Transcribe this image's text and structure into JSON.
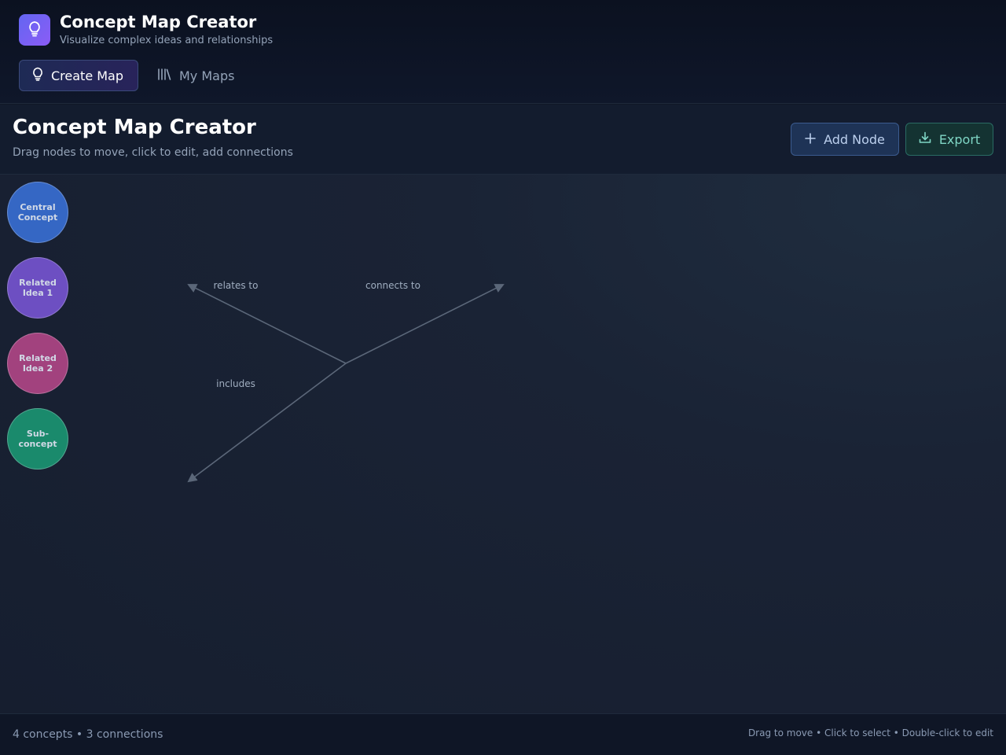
{
  "app": {
    "title": "Concept Map Creator",
    "subtitle": "Visualize complex ideas and relationships",
    "logo_icon": "lightbulb-icon"
  },
  "tabs": [
    {
      "label": "Create Map",
      "icon": "lightbulb-icon",
      "active": true
    },
    {
      "label": "My Maps",
      "icon": "library-icon",
      "active": false
    }
  ],
  "toolbar": {
    "title": "Concept Map Creator",
    "hint": "Drag nodes to move, click to edit, add connections",
    "add_node_label": "Add Node",
    "export_label": "Export"
  },
  "nodes": [
    {
      "line1": "Central",
      "line2": "Concept",
      "color": "#3567c4"
    },
    {
      "line1": "Related",
      "line2": "Idea 1",
      "color": "#6d4fc2"
    },
    {
      "line1": "Related",
      "line2": "Idea 2",
      "color": "#a2427e"
    },
    {
      "line1": "Sub-",
      "line2": "concept",
      "color": "#1a8a6c"
    }
  ],
  "connections": [
    {
      "label": "relates to"
    },
    {
      "label": "connects to"
    },
    {
      "label": "includes"
    }
  ],
  "footer": {
    "stats": "4 concepts • 3 connections",
    "help": "Drag to move • Click to select • Double-click to edit"
  },
  "colors": {
    "accent": "#6366f1",
    "edge": "#5b6779"
  }
}
